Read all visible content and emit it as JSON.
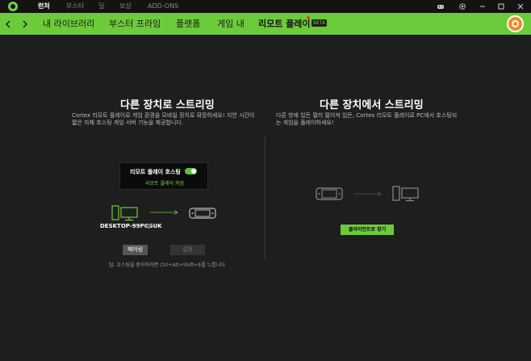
{
  "topbar": {
    "nav": [
      "런처",
      "부스터",
      "딜",
      "보상",
      "ADD-ONS"
    ],
    "active_index": 0
  },
  "subnav": {
    "back_icon": "chevron-left-icon",
    "forward_icon": "chevron-right-icon",
    "tabs": [
      "내 라이브러리",
      "부스터 프라임",
      "플랫폼",
      "게임 내",
      "리모트 플레이"
    ],
    "active_tab": "리모트 플레이",
    "beta_badge": "BETA"
  },
  "left_panel": {
    "title": "다른 장치로 스트리밍",
    "desc_line1": "Cortex 리모트 플레이로 게임 환경을 모바일 장치로 확장하세요! 지연 시간이",
    "desc_line2": "짧은 자체 호스팅 게임 서버 기능을 제공합니다.",
    "hosting_label": "리모트 플레이 호스팅",
    "hosting_enabled": true,
    "hosting_status": "리모트 플레이 켜짐",
    "device_name": "DESKTOP-99PCGUK",
    "pairing_button": "페어링",
    "settings_button": "설정",
    "tip": "팁: 호스팅을 중지하려면 Ctrl+Alt+Shift+E를 누릅니다"
  },
  "right_panel": {
    "title": "다른 장치에서 스트리밍",
    "desc_line1": "다른 방에 있든 멀리 떨어져 있든, Cortex 리모트 플레이로 PC에서 호스팅되",
    "desc_line2": "는 게임을 플레이하세요!",
    "find_button": "클라이언트로 찾기"
  },
  "colors": {
    "accent": "#6ccb3a",
    "background": "#1e1e1e",
    "topbar": "#131313",
    "avatar": "#f28a1c"
  }
}
